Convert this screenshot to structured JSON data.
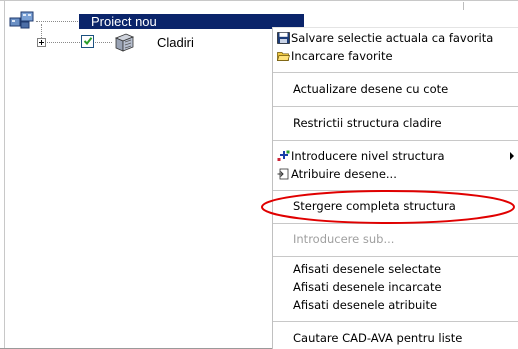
{
  "tree": {
    "root": {
      "label": "Proiect nou",
      "icon": "project-icon"
    },
    "children": [
      {
        "label": "Cladiri",
        "checked": true,
        "icon": "building-icon"
      }
    ]
  },
  "menu": {
    "items": [
      {
        "label": "Salvare selectie actuala ca favorita",
        "icon": "save-disk-icon",
        "disabled": false
      },
      {
        "label": "Incarcare favorite",
        "icon": "open-folder-icon",
        "disabled": false
      },
      {
        "label": "Actualizare desene cu cote",
        "disabled": false
      },
      {
        "label": "Restrictii structura cladire",
        "disabled": false
      },
      {
        "label": "Introducere nivel structura",
        "icon": "add-level-icon",
        "submenu": true,
        "disabled": false
      },
      {
        "label": "Atribuire desene...",
        "icon": "assign-drawing-icon",
        "disabled": false
      },
      {
        "label": "Stergere completa structura",
        "disabled": false,
        "highlighted": true
      },
      {
        "label": "Introducere sub...",
        "disabled": true
      },
      {
        "label": "Afisati desenele selectate",
        "disabled": false
      },
      {
        "label": "Afisati desenele incarcate",
        "disabled": false
      },
      {
        "label": "Afisati desenele atribuite",
        "disabled": false
      },
      {
        "label": "Cautare CAD-AVA pentru liste",
        "disabled": false
      }
    ]
  },
  "colors": {
    "selection": "#0a246a",
    "annotation_ellipse": "#e00000",
    "disabled_text": "#a0a0a0"
  }
}
